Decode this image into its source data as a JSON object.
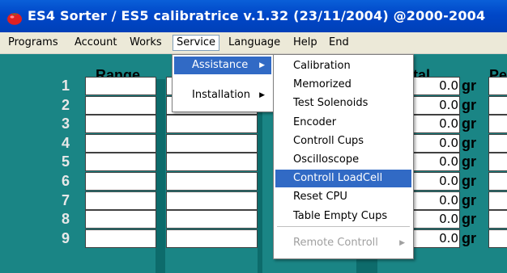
{
  "window": {
    "title": "ES4 Sorter / ES5 calibratrice  v.1.32 (23/11/2004) @2000-2004",
    "icon": "tomato-icon"
  },
  "menubar": {
    "programs": "Programs",
    "account": "Account",
    "works": "Works",
    "service": "Service",
    "language": "Language",
    "help": "Help",
    "end": "End"
  },
  "table": {
    "range_header": "Range",
    "total_header": "tal",
    "pe_header": "Pe",
    "rows": [
      "1",
      "2",
      "3",
      "4",
      "5",
      "6",
      "7",
      "8",
      "9"
    ],
    "totals": [
      "0.0",
      "0.0",
      "0.0",
      "0.0",
      "0.0",
      "0.0",
      "0.0",
      "0.0",
      "0.0"
    ],
    "unit": "gr"
  },
  "service_menu": {
    "assistance": "Assistance",
    "installation": "Installation"
  },
  "assistance_menu": {
    "items": [
      "Calibration",
      "Memorized",
      "Test Solenoids",
      "Encoder",
      "Controll Cups",
      "Oscilloscope",
      "Controll LoadCell",
      "Reset CPU",
      "Table Empty Cups"
    ],
    "remote": "Remote Controll"
  },
  "colors": {
    "background_teal": "#1a8585",
    "title_blue": "#0047c8",
    "highlight": "#316ac5"
  }
}
